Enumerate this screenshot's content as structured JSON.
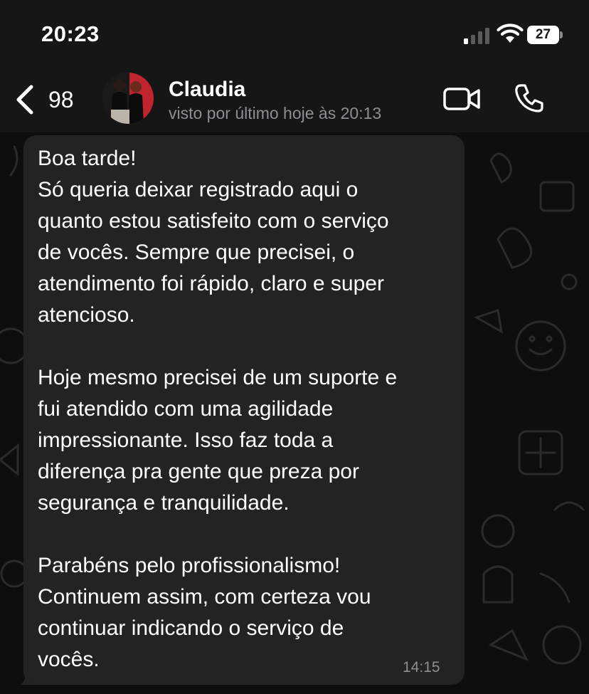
{
  "status_bar": {
    "time": "20:23",
    "battery_level": "27",
    "signal_bars_active": 1,
    "signal_bars_total": 4
  },
  "header": {
    "back_count": "98",
    "contact_name": "Claudia",
    "last_seen": "visto por último hoje às 20:13",
    "icons": [
      "chevron-left-icon",
      "video-call-icon",
      "phone-icon"
    ]
  },
  "message": {
    "lines": [
      "Boa tarde!",
      "Só queria deixar registrado aqui o",
      "quanto estou satisfeito com o serviço",
      "de vocês. Sempre que precisei, o",
      "atendimento foi rápido, claro e super",
      "atencioso.",
      "",
      "Hoje mesmo precisei de um suporte e",
      "fui atendido com uma agilidade",
      "impressionante. Isso faz toda a",
      "diferença pra gente que preza por",
      "segurança e tranquilidade.",
      "",
      "Parabéns pelo profissionalismo!",
      "Continuem assim, com certeza vou",
      "continuar indicando o serviço de",
      "vocês."
    ],
    "time": "14:15"
  },
  "colors": {
    "bubble": "#232323",
    "header_bg": "#161616",
    "secondary_text": "#8e8e93"
  }
}
